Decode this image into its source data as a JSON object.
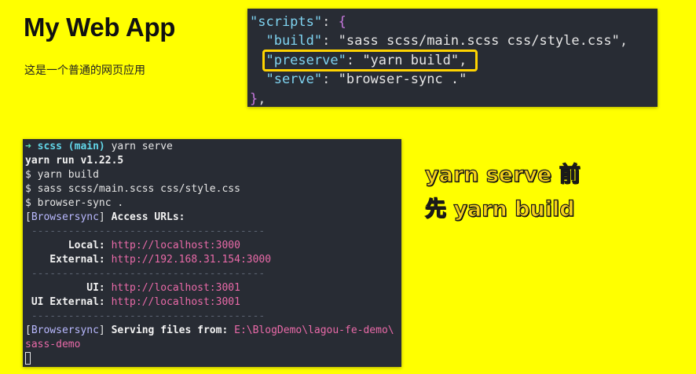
{
  "app": {
    "title": "My Web App",
    "description": "这是一个普通的网页应用"
  },
  "code": {
    "lines": [
      [
        {
          "t": "\"scripts\"",
          "c": "k"
        },
        {
          "t": ": ",
          "c": "punc"
        },
        {
          "t": "{",
          "c": "p"
        }
      ],
      [
        {
          "t": "  \"build\"",
          "c": "k"
        },
        {
          "t": ": ",
          "c": "punc"
        },
        {
          "t": "\"sass scss/main.scss css/style.css\"",
          "c": "s"
        },
        {
          "t": ",",
          "c": "punc"
        }
      ],
      [
        {
          "t": "  \"preserve\"",
          "c": "k"
        },
        {
          "t": ": ",
          "c": "punc"
        },
        {
          "t": "\"yarn build\"",
          "c": "s"
        },
        {
          "t": ",",
          "c": "punc"
        }
      ],
      [
        {
          "t": "  \"serve\"",
          "c": "k"
        },
        {
          "t": ": ",
          "c": "punc"
        },
        {
          "t": "\"browser-sync .\"",
          "c": "s"
        }
      ],
      [
        {
          "t": "}",
          "c": "p"
        },
        {
          "t": ",",
          "c": "punc"
        }
      ]
    ]
  },
  "terminal": {
    "lines": [
      [
        {
          "t": "➜ ",
          "c": "green"
        },
        {
          "t": "scss ",
          "c": "cyan"
        },
        {
          "t": "(main)",
          "c": "cyan"
        },
        {
          "t": " yarn serve",
          "c": ""
        }
      ],
      [
        {
          "t": "yarn run v1.22.5",
          "c": "bold"
        }
      ],
      [
        {
          "t": "$ yarn build",
          "c": ""
        }
      ],
      [
        {
          "t": "$ sass scss/main.scss css/style.css",
          "c": ""
        }
      ],
      [
        {
          "t": "$ browser-sync .",
          "c": ""
        }
      ],
      [
        {
          "t": "[",
          "c": ""
        },
        {
          "t": "Browsersync",
          "c": "bs"
        },
        {
          "t": "] ",
          "c": ""
        },
        {
          "t": "Access URLs:",
          "c": "bold"
        }
      ],
      [
        {
          "t": " --------------------------------------",
          "c": "dim"
        }
      ],
      [
        {
          "t": "       Local: ",
          "c": "bold"
        },
        {
          "t": "http://localhost:3000",
          "c": "url"
        }
      ],
      [
        {
          "t": "    External: ",
          "c": "bold"
        },
        {
          "t": "http://192.168.31.154:3000",
          "c": "url"
        }
      ],
      [
        {
          "t": " --------------------------------------",
          "c": "dim"
        }
      ],
      [
        {
          "t": "          UI: ",
          "c": "bold"
        },
        {
          "t": "http://localhost:3001",
          "c": "url"
        }
      ],
      [
        {
          "t": " UI External: ",
          "c": "bold"
        },
        {
          "t": "http://localhost:3001",
          "c": "url"
        }
      ],
      [
        {
          "t": " --------------------------------------",
          "c": "dim"
        }
      ],
      [
        {
          "t": "[",
          "c": ""
        },
        {
          "t": "Browsersync",
          "c": "bs"
        },
        {
          "t": "] ",
          "c": ""
        },
        {
          "t": "Serving files from: ",
          "c": "bold"
        },
        {
          "t": "E:\\BlogDemo\\lagou-fe-demo\\",
          "c": "url"
        }
      ],
      [
        {
          "t": "sass-demo",
          "c": "url"
        }
      ]
    ]
  },
  "annotation": {
    "line1": "yarn serve 前",
    "line2": "先 yarn build"
  },
  "colors": {
    "background": "#ffff00",
    "highlight": "#ffd400",
    "panel": "#282c34"
  }
}
